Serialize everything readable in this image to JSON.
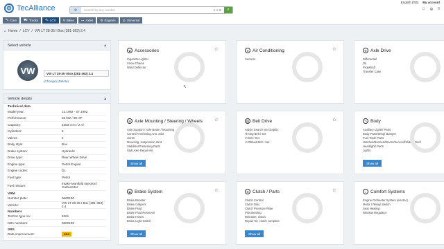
{
  "header": {
    "brand": "TecAlliance",
    "search_placeholder": "Search by any number",
    "search_prefix": "⚙",
    "search_flags": "$ ☷ ⊞",
    "language": "English (GB)",
    "account": "My account",
    "tabs": [
      {
        "label": "Cars",
        "icon": "car-icon"
      },
      {
        "label": "Trucks",
        "icon": "truck-icon"
      },
      {
        "label": "LCV",
        "icon": "van-icon"
      },
      {
        "label": "Bikes",
        "icon": "bike-icon"
      },
      {
        "label": "Axles",
        "icon": "axle-icon"
      },
      {
        "label": "Engines",
        "icon": "engine-icon"
      },
      {
        "label": "Universal",
        "icon": "universal-icon"
      }
    ],
    "active_tab": "LCV"
  },
  "breadcrumb": [
    "Home",
    "LCV",
    "VW LT 28-35 I Box (281-363) 2.4"
  ],
  "select_vehicle": {
    "heading": "Select vehicle",
    "vehicle_name": "VW LT 28-35 I Box (281-363) 2.4",
    "change": "(Change)",
    "delete": "(Delete)",
    "brand_logo": "VW"
  },
  "vehicle_details": {
    "heading": "Vehicle details",
    "sections": [
      {
        "title": "Technical data",
        "rows": [
          [
            "Model year:",
            "12.1982 - 07.1992"
          ],
          [
            "Performance:",
            "66 kW / 90 HP"
          ],
          [
            "Capacity:",
            "2383 ccm / 2.4 l"
          ],
          [
            "Cylinders:",
            "6"
          ],
          [
            "Valves:",
            "2"
          ],
          [
            "Body style:",
            "Box"
          ],
          [
            "Brake system:",
            "Hydraulic"
          ],
          [
            "Drive type:",
            "Rear Wheel Drive"
          ],
          [
            "Engine type:",
            "Petrol Engine"
          ],
          [
            "Engine codes:",
            "DL"
          ],
          [
            "Fuel type:",
            "Petrol"
          ],
          [
            "Fuel mixture:",
            "Intake Manifold Injection/ Carburettor"
          ]
        ]
      },
      {
        "title": "VRM",
        "rows": [
          [
            "Number plate:",
            "0600100"
          ],
          [
            "Vehicle:",
            "VW LT 28-35 I Box (281-363) 2.4"
          ]
        ]
      },
      {
        "title": "Numbers",
        "rows": [
          [
            "TecDoc type no.:",
            "6361"
          ],
          [
            "KBA numbers:",
            "0600100"
          ]
        ]
      },
      {
        "title": "SRS",
        "rows": [
          [
            "Data improvement:",
            "SRS"
          ]
        ]
      }
    ]
  },
  "categories": [
    {
      "title": "Accessories",
      "items": [
        "Cigarette Lighter",
        "Snow Chains",
        "Wind Deflector"
      ],
      "button": ""
    },
    {
      "title": "Air Conditioning",
      "items": [
        "Sensors"
      ],
      "button": ""
    },
    {
      "title": "Axle Drive",
      "items": [
        "Differential",
        "Oil",
        "Propshaft",
        "Transfer Case"
      ],
      "button": ""
    },
    {
      "title": "Axle Mounting / Steering / Wheels",
      "items": [
        "Axle Support / Axle Beam / Mounting",
        "Control Arm/Swing Arm Joint",
        "Joints",
        "Mounting, suspension strut",
        "Stabiliser/Fastening Parts",
        "Stub Axle Repair Kit"
      ],
      "button": "Show all"
    },
    {
      "title": "Belt Drive",
      "items": [
        "Article Search via Graphic",
        "Timing Belt / Set",
        "V-Belt / Set",
        "V-Ribbed Belt / Set"
      ],
      "button": ""
    },
    {
      "title": "Body",
      "items": [
        "Auxiliary Lights/ Parts",
        "Body Parts/Wing/ Bumper",
        "Fuel Tank/ Parts",
        "Hatches/Bonnets/Doors/Sunroof/Sliding Roof",
        "Headlight/ Parts",
        "Lights"
      ],
      "button": "Show all"
    },
    {
      "title": "Brake System",
      "items": [
        "Brake Booster",
        "Brake Calipers",
        "Brake Fluid",
        "Brake Fluid Reservoir",
        "Brake Hoses",
        "Brake Light Switch"
      ],
      "button": "Show all"
    },
    {
      "title": "Clutch / Parts",
      "items": [
        "Clutch Control",
        "Clutch Disc",
        "Clutch Pressure Plate",
        "Pilot Bearing",
        "Releaser, clutch",
        "Repair Kit, clutch complete"
      ],
      "button": "Show all"
    },
    {
      "title": "Comfort Systems",
      "items": [
        "Engine Preheater System (electric)",
        "Motor / Relay/ Switch",
        "Seat Heating",
        "Window Regulator"
      ],
      "button": ""
    }
  ]
}
